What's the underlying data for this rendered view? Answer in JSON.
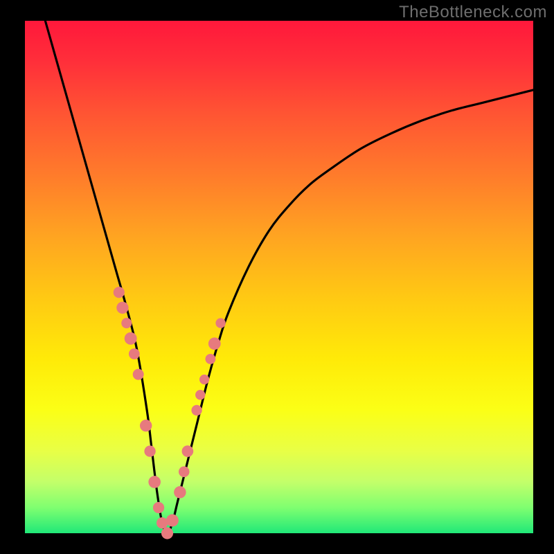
{
  "watermark": "TheBottleneck.com",
  "colors": {
    "frame_bg": "#000000",
    "watermark_text": "#6e6e6e",
    "curve_stroke": "#000000",
    "marker_fill": "#e77a7e",
    "gradient_top": "#ff183b",
    "gradient_bottom": "#20e878"
  },
  "chart_data": {
    "type": "line",
    "title": "",
    "xlabel": "",
    "ylabel": "",
    "xlim": [
      0,
      100
    ],
    "ylim": [
      0,
      100
    ],
    "grid": false,
    "legend": false,
    "series": [
      {
        "name": "v-curve",
        "x": [
          4,
          6,
          8,
          10,
          12,
          14,
          16,
          18,
          20,
          22,
          24,
          25,
          26,
          27,
          28,
          29,
          30,
          32,
          34,
          36,
          38,
          40,
          44,
          48,
          52,
          56,
          60,
          66,
          72,
          78,
          84,
          90,
          96,
          100
        ],
        "y": [
          100,
          93,
          86,
          79,
          72,
          65,
          58,
          51,
          44,
          36,
          24,
          16,
          8,
          2,
          0,
          2,
          6,
          14,
          22,
          30,
          37,
          43,
          52,
          59,
          64,
          68,
          71,
          75,
          78,
          80.5,
          82.5,
          84,
          85.5,
          86.5
        ]
      }
    ],
    "markers": {
      "name": "highlight-points",
      "x": [
        18.5,
        19.2,
        20.0,
        20.8,
        21.5,
        22.3,
        23.8,
        24.6,
        25.5,
        26.3,
        27.0,
        28.0,
        29.0,
        30.5,
        31.3,
        32.0,
        33.8,
        34.5,
        35.3,
        36.5,
        37.3,
        38.5
      ],
      "y": [
        47,
        44,
        41,
        38,
        35,
        31,
        21,
        16,
        10,
        5,
        2,
        0,
        2.5,
        8,
        12,
        16,
        24,
        27,
        30,
        34,
        37,
        41
      ]
    },
    "annotations": []
  }
}
